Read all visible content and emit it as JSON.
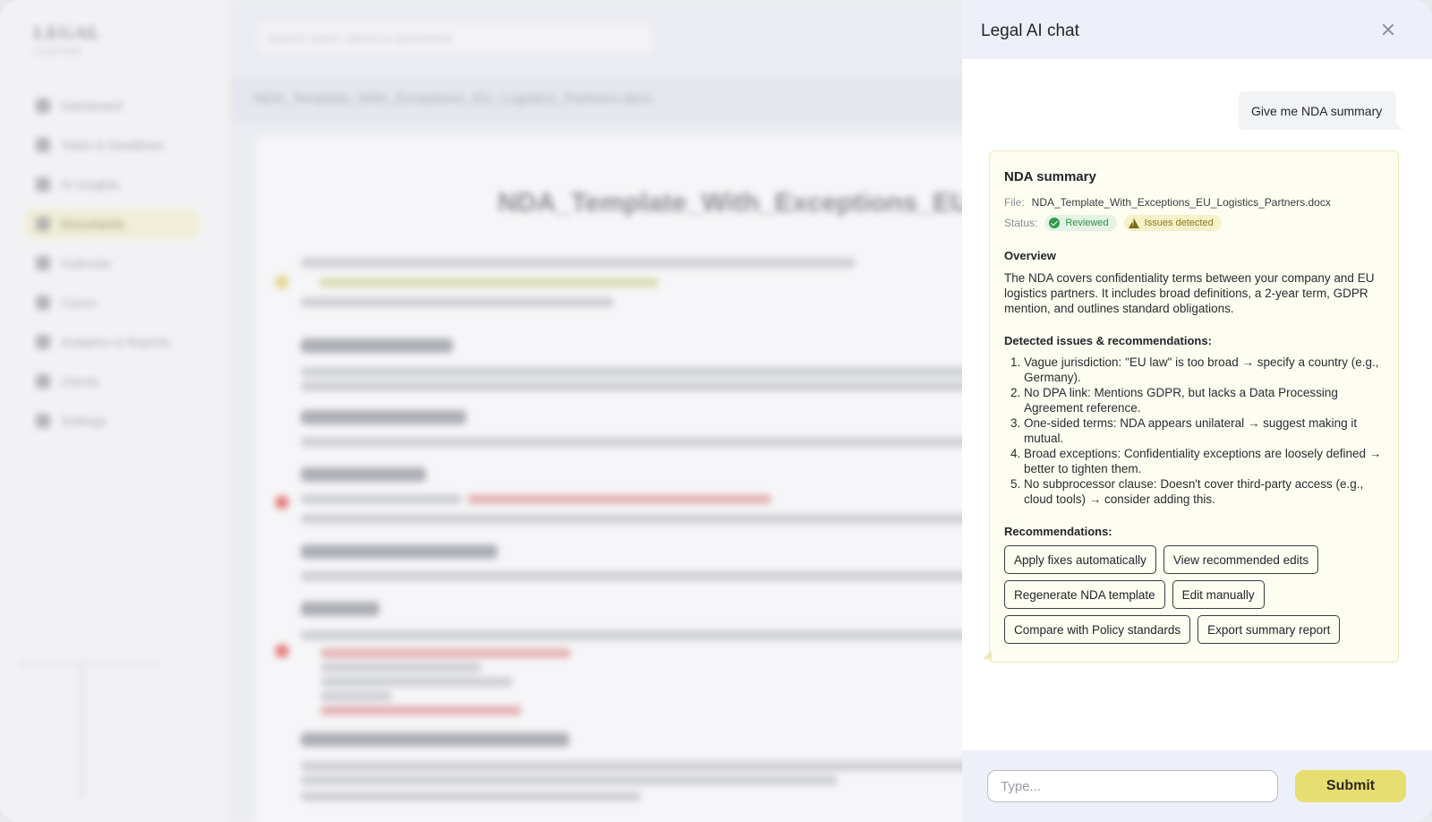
{
  "background": {
    "logo": "LEGAL",
    "logo_sub": "CUSTOM",
    "nav": [
      "Dashboard",
      "Tasks & Deadlines",
      "AI Insights",
      "Documents",
      "Calendar",
      "Cases",
      "Analytics & Reports",
      "Clients",
      "Settings"
    ],
    "active_nav": "Documents",
    "search_placeholder": "Search cases, clients or documents",
    "doc_filename": "NDA_Template_With_Exceptions_EU_Logistics_Partners.docx",
    "doc_title": "NDA_Template_With_Exceptions_EU_L",
    "headings": [
      "Position and Job Title",
      "2. Term of Employment",
      "3. Compensation",
      "4. Work Hours and Location",
      "5. Benefits",
      "6. Confidentiality and Non-Disclosure"
    ]
  },
  "chat": {
    "title": "Legal AI chat",
    "user_message": "Give me NDA summary",
    "summary": {
      "title": "NDA summary",
      "file_label": "File:",
      "file_name": "NDA_Template_With_Exceptions_EU_Logistics_Partners.docx",
      "status_label": "Status:",
      "badge_reviewed": "Reviewed",
      "badge_issues": "Issues detected",
      "overview_heading": "Overview",
      "overview_text": "The NDA covers confidentiality terms between your company and EU logistics partners. It includes broad definitions, a 2-year term, GDPR mention, and outlines standard obligations.",
      "issues_heading": "Detected issues & recommendations:",
      "issues": [
        "Vague jurisdiction: \"EU law\" is too broad → specify a country (e.g., Germany).",
        "No DPA link: Mentions GDPR, but lacks a Data Processing Agreement reference.",
        "One-sided terms: NDA appears unilateral → suggest making it mutual.",
        "Broad exceptions: Confidentiality exceptions are loosely defined → better to tighten them.",
        "No subprocessor clause: Doesn't cover third-party access (e.g., cloud tools) → consider adding this."
      ],
      "recommendations_heading": "Recommendations:",
      "actions": [
        "Apply fixes automatically",
        "View recommended edits",
        "Regenerate NDA template",
        "Edit manually",
        "Compare with Policy standards",
        "Export summary report"
      ]
    },
    "input_placeholder": "Type...",
    "input_value": "",
    "submit_label": "Submit"
  },
  "colors": {
    "accent": "#e8dd70",
    "panel_header": "#eef0f9",
    "card_bg": "#fdfdf1",
    "reviewed_green": "#2f9a4a",
    "issues_yellow": "#f6f1c9"
  }
}
